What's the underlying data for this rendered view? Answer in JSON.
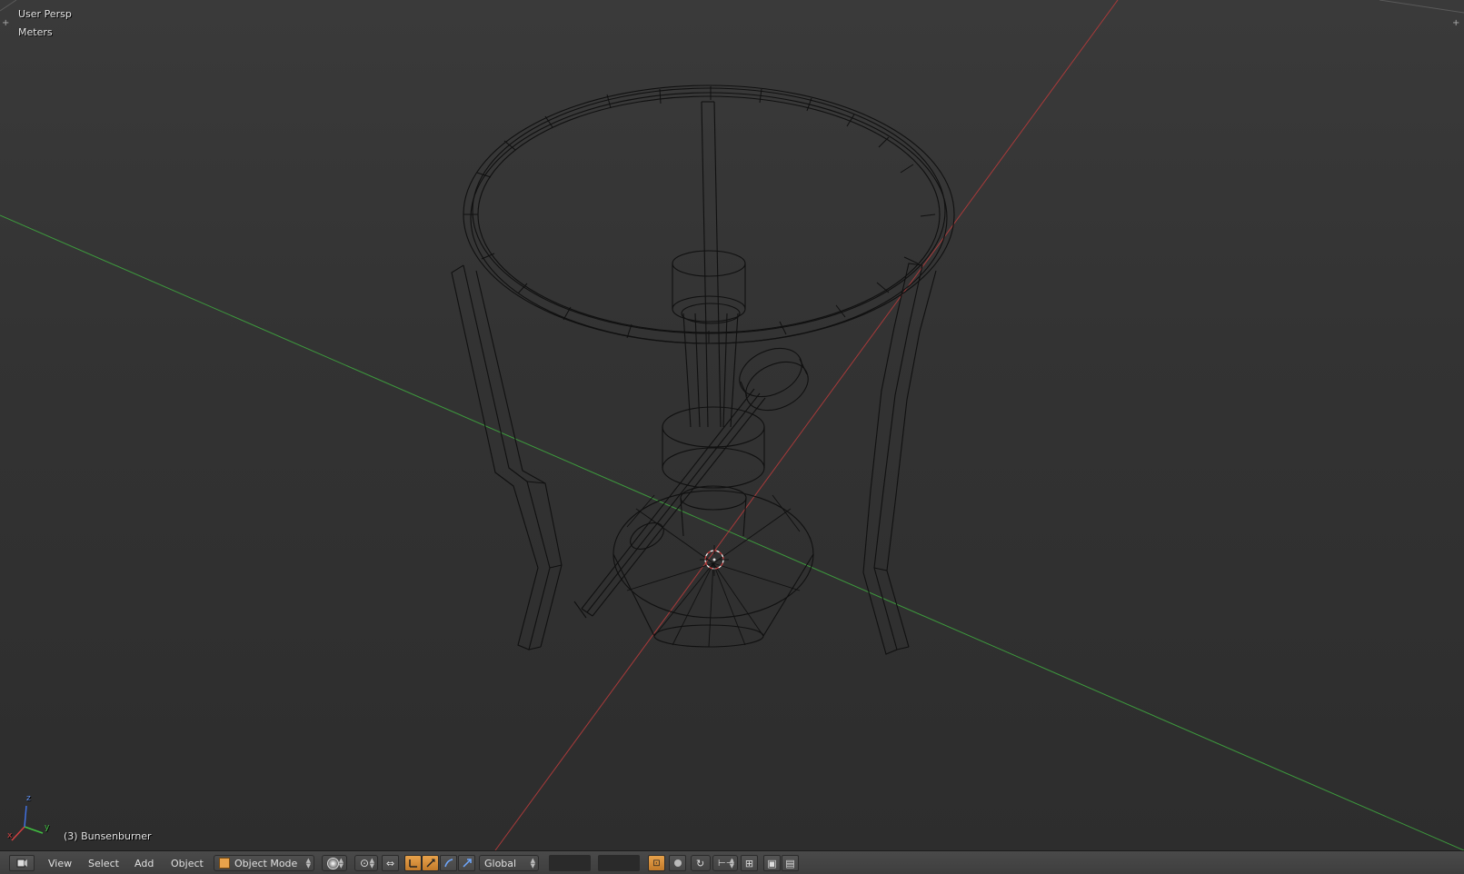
{
  "viewport": {
    "view_name": "User Persp",
    "units": "Meters",
    "object_label": "(3) Bunsenburner",
    "axis_labels": {
      "x": "x",
      "y": "y",
      "z": "z"
    },
    "colors": {
      "x_axis": "#b03a3a",
      "y_axis": "#3a9a3a",
      "wire": "#111111",
      "background": "#393939"
    }
  },
  "header": {
    "menus": [
      "View",
      "Select",
      "Add",
      "Object"
    ],
    "mode": "Object Mode",
    "orientation": "Global",
    "icons": {
      "editor_type": "3d-view-icon",
      "mode": "object-mode-cube-icon",
      "shading": "viewport-shading-icon",
      "pivot": "pivot-point-icon",
      "manipulator": "manipulator-icon",
      "translate": "translate-icon",
      "rotate": "rotate-icon",
      "scale": "scale-icon",
      "lock_layers": "lock-layers-icon",
      "render_layer": "render-layer-icon",
      "proportional": "proportional-edit-icon",
      "snap": "snap-icon",
      "snap_target": "snap-target-icon",
      "opengl_render": "camera-render-icon",
      "opengl_anim": "clapper-render-icon"
    }
  }
}
